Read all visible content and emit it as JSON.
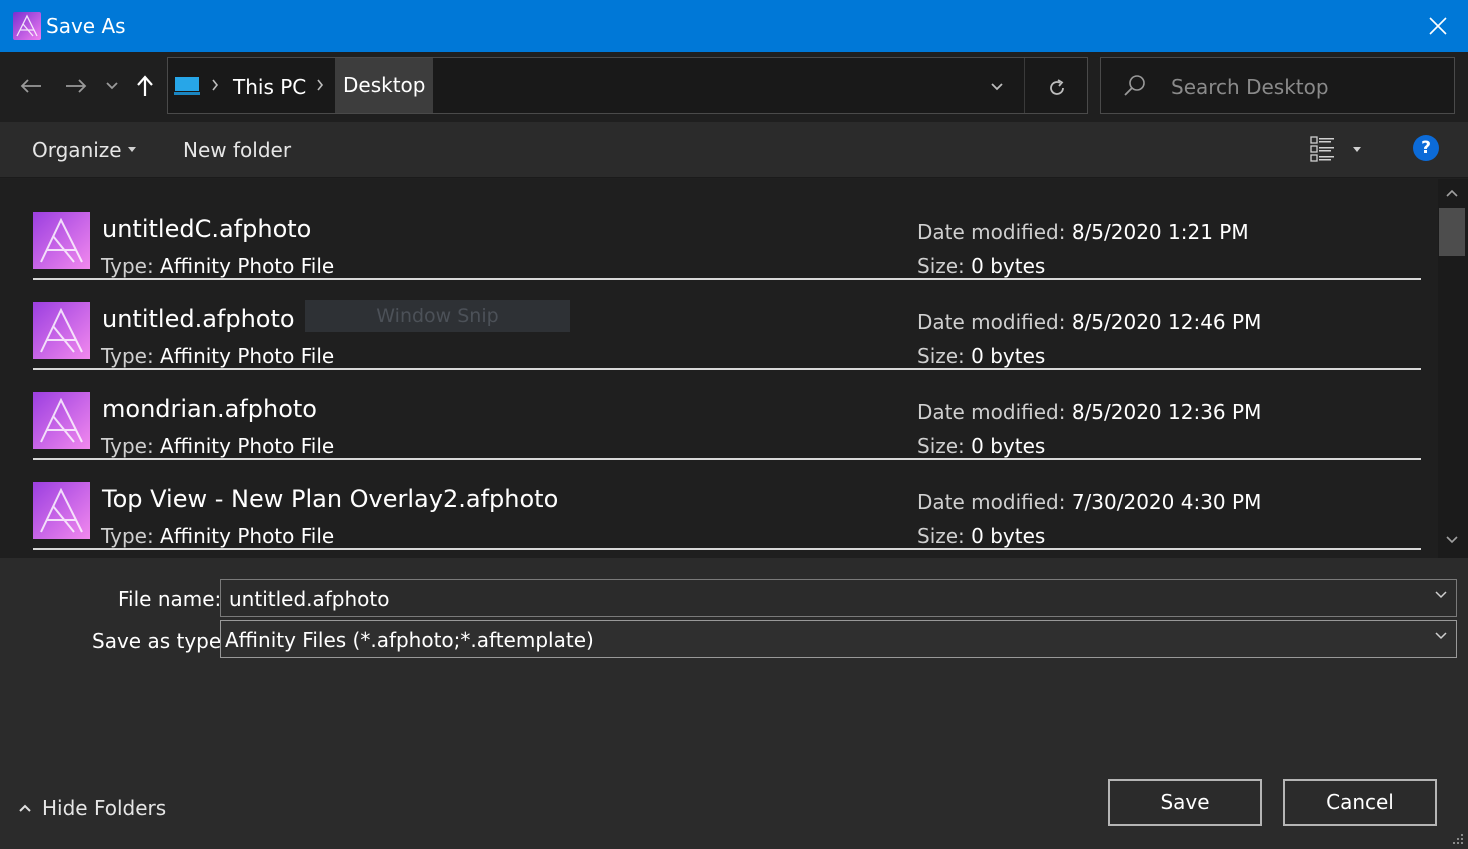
{
  "window": {
    "title": "Save As"
  },
  "address": {
    "crumbs": [
      "This PC",
      "Desktop"
    ]
  },
  "search": {
    "placeholder": "Search Desktop"
  },
  "toolbar": {
    "organize_label": "Organize",
    "new_folder_label": "New folder",
    "help_label": "?"
  },
  "files": [
    {
      "name": "untitledC.afphoto",
      "type_label": "Type:",
      "type": "Affinity Photo File",
      "date_label": "Date modified:",
      "date": "8/5/2020 1:21 PM",
      "size_label": "Size:",
      "size": "0 bytes"
    },
    {
      "name": "untitled.afphoto",
      "type_label": "Type:",
      "type": "Affinity Photo File",
      "date_label": "Date modified:",
      "date": "8/5/2020 12:46 PM",
      "size_label": "Size:",
      "size": "0 bytes"
    },
    {
      "name": "mondrian.afphoto",
      "type_label": "Type:",
      "type": "Affinity Photo File",
      "date_label": "Date modified:",
      "date": "8/5/2020 12:36 PM",
      "size_label": "Size:",
      "size": "0 bytes"
    },
    {
      "name": "Top View - New Plan Overlay2.afphoto",
      "type_label": "Type:",
      "type": "Affinity Photo File",
      "date_label": "Date modified:",
      "date": "7/30/2020 4:30 PM",
      "size_label": "Size:",
      "size": "0 bytes"
    }
  ],
  "overlay": {
    "snip_text": "Window Snip"
  },
  "form": {
    "file_name_label": "File name:",
    "file_name_value": "untitled.afphoto",
    "save_type_label": "Save as type:",
    "save_type_value": "Affinity Files (*.afphoto;*.aftemplate)"
  },
  "footer": {
    "hide_folders_label": "Hide Folders",
    "save_label": "Save",
    "cancel_label": "Cancel"
  },
  "colors": {
    "title_bar": "#0078d7",
    "background": "#202020",
    "panel": "#2b2b2b",
    "help": "#0c6bd8",
    "affinity_photo": "#d44fd8"
  }
}
